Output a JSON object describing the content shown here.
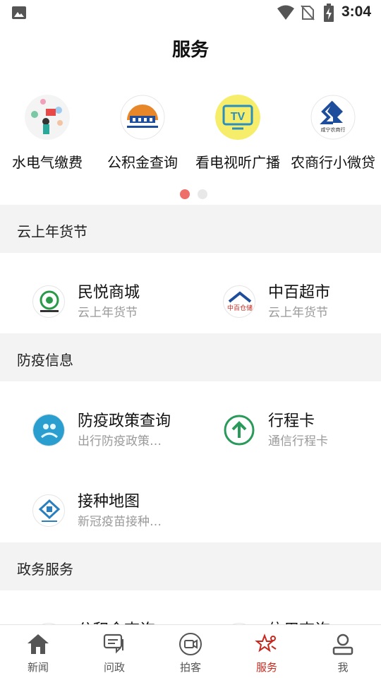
{
  "status_bar": {
    "time": "3:04"
  },
  "page_title": "服务",
  "carousel": {
    "items": [
      {
        "label": "水电气缴费",
        "icon": "utilities-payment-icon"
      },
      {
        "label": "公积金查询",
        "icon": "housing-fund-icon"
      },
      {
        "label": "看电视听广播",
        "icon": "tv-icon"
      },
      {
        "label": "农商行小微贷",
        "icon": "rural-bank-icon"
      }
    ],
    "page_count": 2,
    "active_page": 1,
    "tv_badge": "TV",
    "bank_logo_text": "咸宁农商行"
  },
  "sections": {
    "new_year": {
      "title": "云上年货节",
      "items": [
        {
          "title": "民悦商城",
          "subtitle": "云上年货节",
          "icon": "minyue-mall-icon"
        },
        {
          "title": "中百超市",
          "subtitle": "云上年货节",
          "icon": "zhongbai-supermarket-icon",
          "logo_text": "中百仓储"
        }
      ]
    },
    "epidemic": {
      "title": "防疫信息",
      "items": [
        {
          "title": "防疫政策查询",
          "subtitle": "出行防疫政策…",
          "icon": "epidemic-policy-icon"
        },
        {
          "title": "行程卡",
          "subtitle": "通信行程卡",
          "icon": "travel-card-icon"
        },
        {
          "title": "接种地图",
          "subtitle": "新冠疫苗接种…",
          "icon": "vaccination-map-icon"
        }
      ]
    },
    "government": {
      "title": "政务服务",
      "items": [
        {
          "title": "公积金查询",
          "icon": "housing-fund-query-icon"
        },
        {
          "title": "信用查询",
          "icon": "credit-query-icon"
        }
      ]
    }
  },
  "tabbar": {
    "tabs": [
      {
        "label": "新闻",
        "icon": "home-icon"
      },
      {
        "label": "问政",
        "icon": "chat-icon"
      },
      {
        "label": "拍客",
        "icon": "video-camera-icon"
      },
      {
        "label": "服务",
        "icon": "service-star-icon"
      },
      {
        "label": "我",
        "icon": "user-icon"
      }
    ],
    "active_index": 3
  },
  "colors": {
    "accent_red": "#c8281e",
    "dot_active": "#ee6e6a",
    "section_bg": "#f3f3f3",
    "subtitle_gray": "#9a9a9a"
  }
}
